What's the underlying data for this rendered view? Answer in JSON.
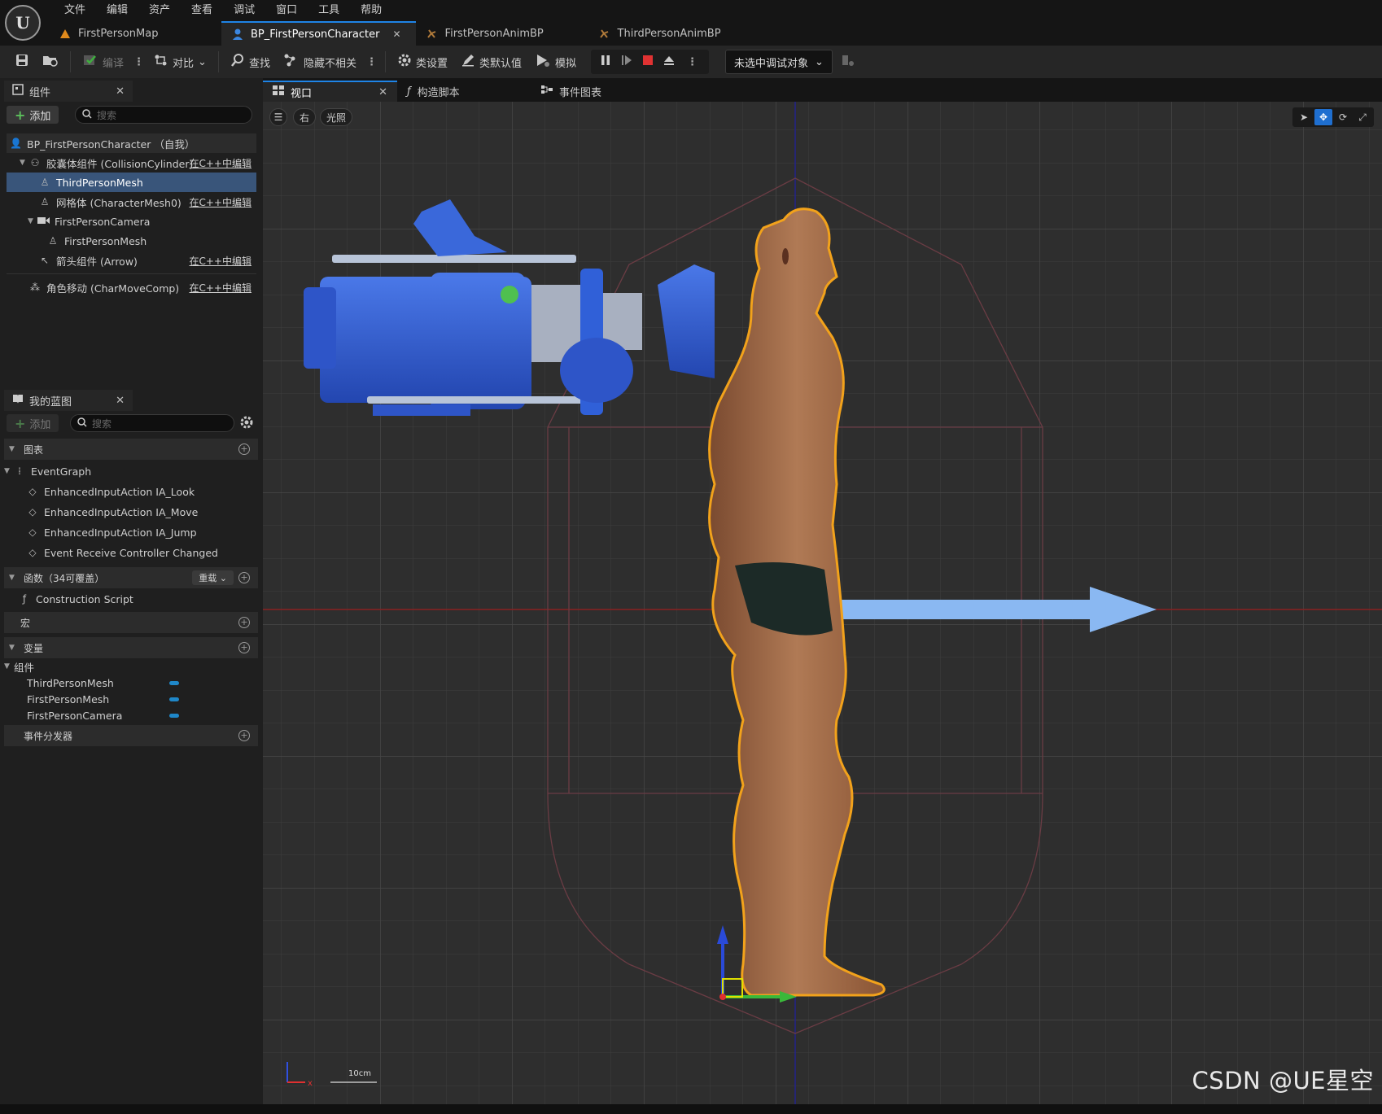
{
  "menu": [
    "文件",
    "编辑",
    "资产",
    "查看",
    "调试",
    "窗口",
    "工具",
    "帮助"
  ],
  "doc_tabs": [
    {
      "label": "FirstPersonMap",
      "icon": "level-icon",
      "color": "#e08a1c"
    },
    {
      "label": "BP_FirstPersonCharacter",
      "icon": "blueprint-character-icon",
      "color": "#3b86e0"
    },
    {
      "label": "FirstPersonAnimBP",
      "icon": "anim-bp-icon",
      "color": "#b07a3a"
    },
    {
      "label": "ThirdPersonAnimBP",
      "icon": "anim-bp-icon",
      "color": "#b07a3a"
    }
  ],
  "toolbar": {
    "compile": "编译",
    "diff": "对比",
    "find": "查找",
    "hide_unrelated": "隐藏不相关",
    "class_settings": "类设置",
    "class_defaults": "类默认值",
    "simulate": "模拟",
    "debug_target": "未选中调试对象"
  },
  "components_panel": {
    "title": "组件",
    "add_label": "添加",
    "search_placeholder": "搜索",
    "edit_cpp": "在C++中编辑",
    "items": [
      {
        "label": "BP_FirstPersonCharacter （自我）",
        "icon": "character-icon"
      },
      {
        "label": "胶囊体组件 (CollisionCylinder)",
        "icon": "capsule-icon"
      },
      {
        "label": "ThirdPersonMesh",
        "icon": "skeletal-mesh-icon"
      },
      {
        "label": "网格体 (CharacterMesh0)",
        "icon": "skeletal-mesh-icon"
      },
      {
        "label": "FirstPersonCamera",
        "icon": "camera-icon"
      },
      {
        "label": "FirstPersonMesh",
        "icon": "skeletal-mesh-icon"
      },
      {
        "label": "箭头组件 (Arrow)",
        "icon": "arrow-component-icon"
      },
      {
        "label": "角色移动 (CharMoveComp)",
        "icon": "movement-icon"
      }
    ]
  },
  "my_blueprint": {
    "title": "我的蓝图",
    "add_label": "添加",
    "search_placeholder": "搜索",
    "graphs_header": "图表",
    "event_graph": "EventGraph",
    "events": [
      "EnhancedInputAction IA_Look",
      "EnhancedInputAction IA_Move",
      "EnhancedInputAction IA_Jump",
      "Event Receive Controller Changed"
    ],
    "functions_header": "函数（34可覆盖）",
    "override_label": "重载",
    "construction_script": "Construction Script",
    "macros_header": "宏",
    "variables_header": "变量",
    "components_group": "组件",
    "variables": [
      "ThirdPersonMesh",
      "FirstPersonMesh",
      "FirstPersonCamera"
    ],
    "dispatchers_header": "事件分发器"
  },
  "editor_tabs": [
    {
      "label": "视口",
      "icon": "viewport-icon"
    },
    {
      "label": "构造脚本",
      "icon": "function-icon"
    },
    {
      "label": "事件图表",
      "icon": "graph-icon"
    }
  ],
  "viewport": {
    "view_label": "右",
    "lighting_label": "光照",
    "scale_label": "10cm",
    "watermark": "CSDN @UE星空",
    "grid_color": "#3e3e3e",
    "selection_outline": "#f2a21b",
    "camera_color": "#2f5fd6",
    "arrow_color": "#8ab8f2"
  }
}
